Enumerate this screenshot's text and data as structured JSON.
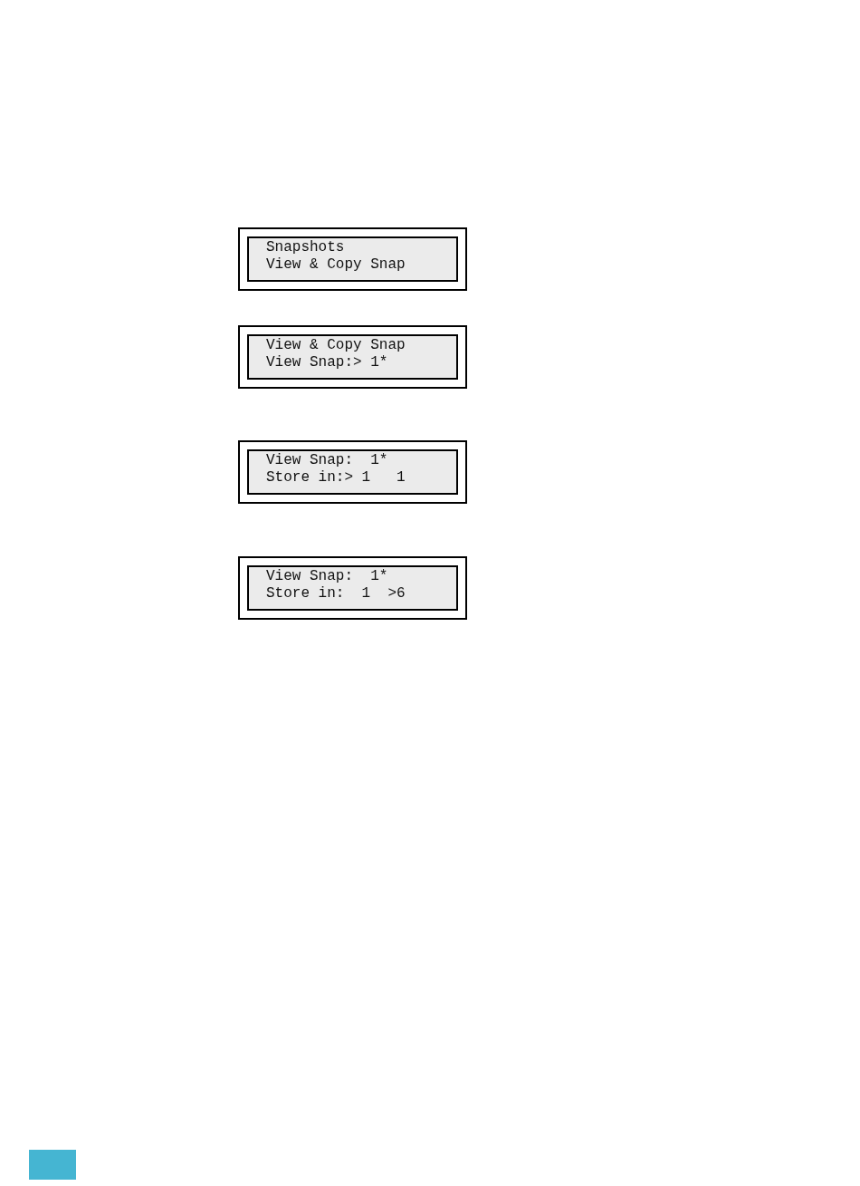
{
  "displays": [
    {
      "lines": [
        "Snapshots",
        "View & Copy Snap"
      ]
    },
    {
      "lines": [
        "View & Copy Snap",
        "View Snap:> 1*"
      ]
    },
    {
      "lines": [
        "View Snap:  1*",
        "Store in:> 1   1"
      ]
    },
    {
      "lines": [
        "View Snap:  1*",
        "Store in:  1  >6"
      ]
    }
  ]
}
